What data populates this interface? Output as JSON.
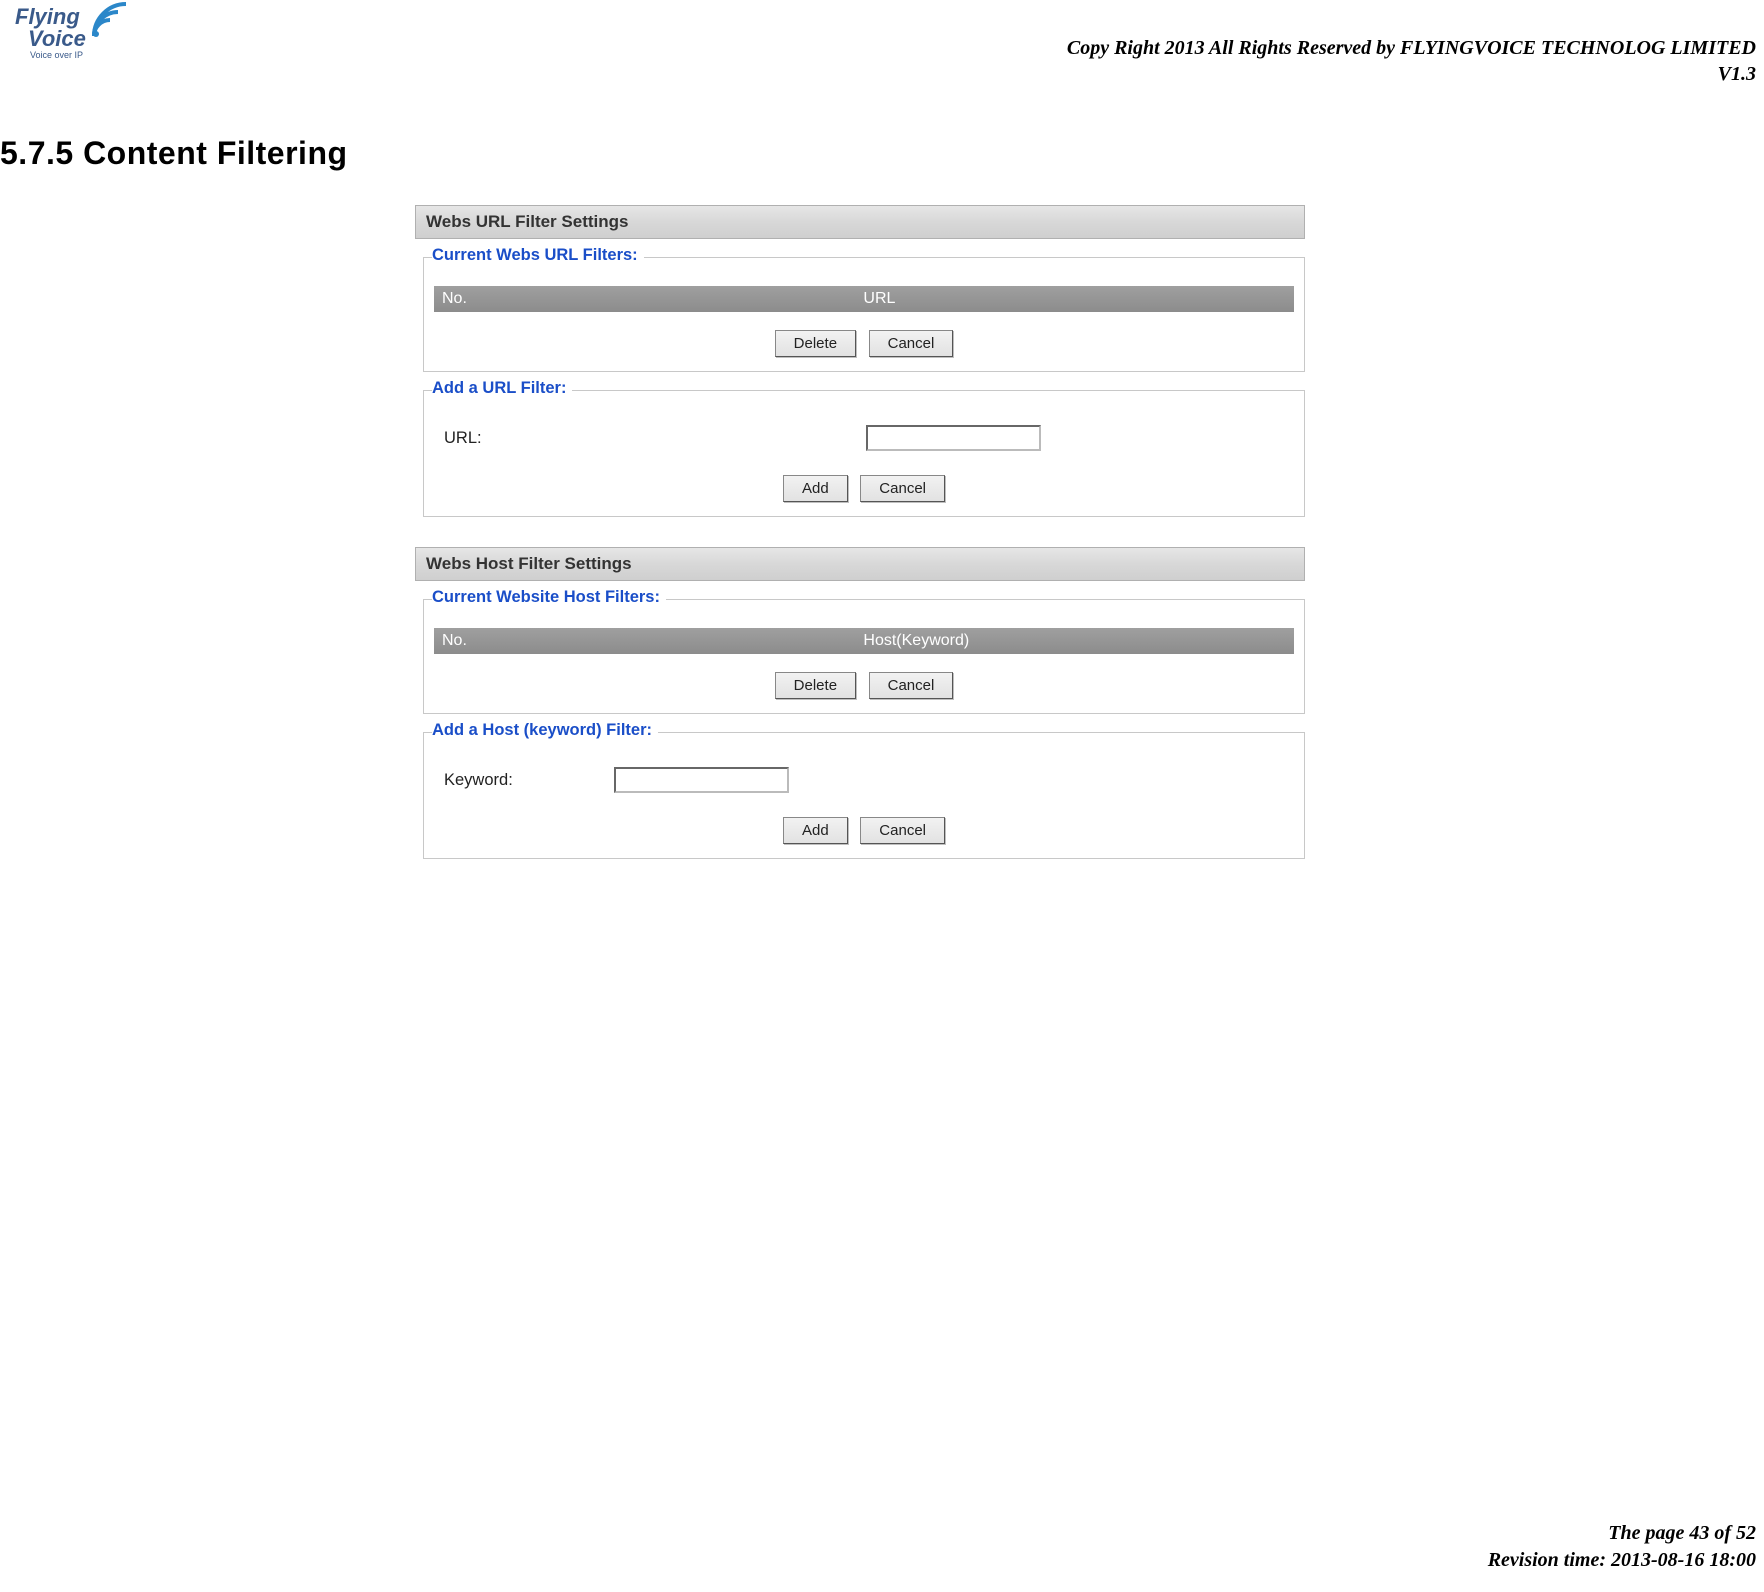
{
  "logo": {
    "line1": "Flying",
    "line2": "Voice",
    "subtitle": "Voice over IP"
  },
  "header": {
    "copyright": "Copy Right 2013 All Rights Reserved by FLYINGVOICE TECHNOLOG LIMITED",
    "version": "V1.3"
  },
  "section_title": "5.7.5 Content Filtering",
  "url_filter": {
    "panel_title": "Webs URL Filter Settings",
    "current_legend": "Current Webs URL Filters:",
    "table_headers": {
      "no": "No.",
      "url": "URL"
    },
    "delete_btn": "Delete",
    "cancel_btn": "Cancel",
    "add_legend": "Add a URL Filter:",
    "url_label": "URL:",
    "url_value": "",
    "add_btn": "Add",
    "add_cancel_btn": "Cancel"
  },
  "host_filter": {
    "panel_title": "Webs Host Filter Settings",
    "current_legend": "Current Website Host Filters:",
    "table_headers": {
      "no": "No.",
      "host": "Host(Keyword)"
    },
    "delete_btn": "Delete",
    "cancel_btn": "Cancel",
    "add_legend": "Add a Host (keyword) Filter:",
    "keyword_label": "Keyword:",
    "keyword_value": "",
    "add_btn": "Add",
    "add_cancel_btn": "Cancel"
  },
  "footer": {
    "page": "The page 43 of 52",
    "revision": "Revision time: 2013-08-16 18:00"
  }
}
